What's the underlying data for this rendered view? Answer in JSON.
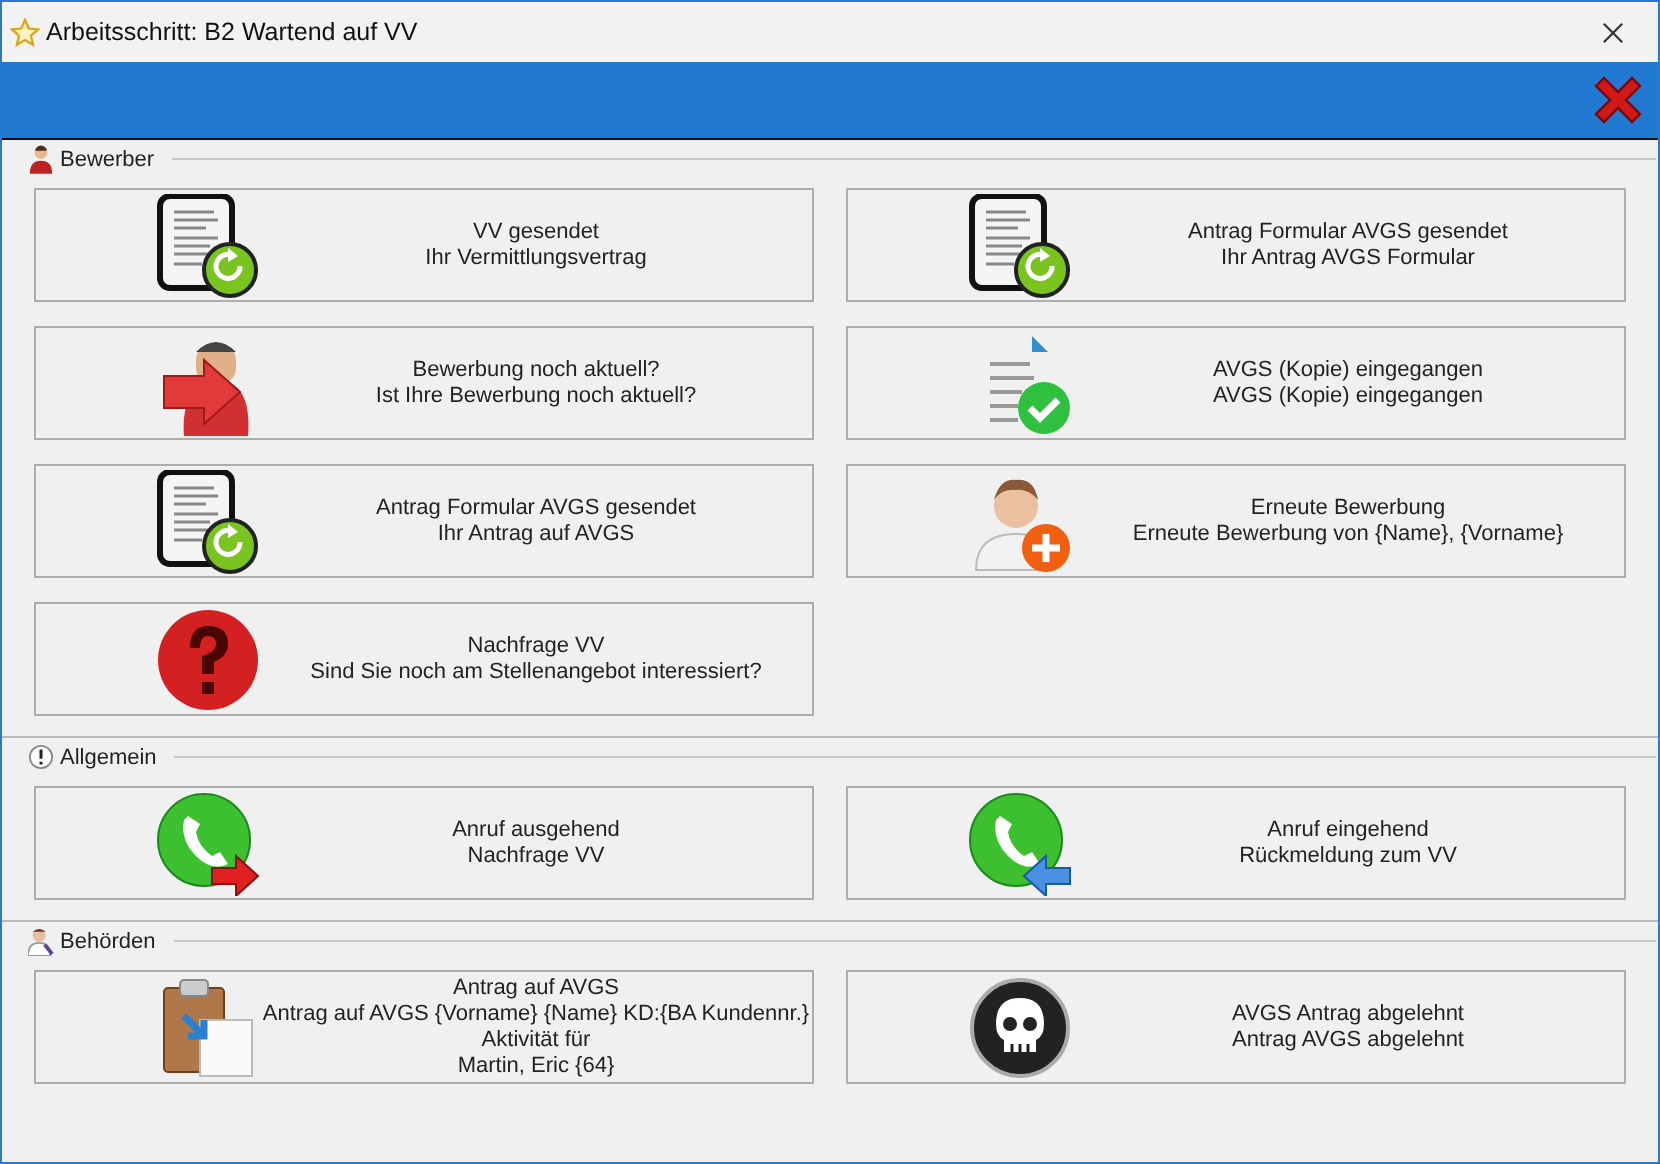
{
  "window": {
    "title": "Arbeitsschritt: B2 Wartend auf VV"
  },
  "sections": [
    {
      "title": "Bewerber",
      "kind": "person",
      "actions": [
        {
          "kind": "doc-refresh",
          "lines": [
            "VV gesendet",
            "Ihr Vermittlungsvertrag"
          ]
        },
        {
          "kind": "doc-refresh",
          "lines": [
            "Antrag Formular AVGS gesendet",
            "Ihr Antrag AVGS Formular"
          ]
        },
        {
          "kind": "person-arrow",
          "lines": [
            "Bewerbung noch aktuell?",
            "Ist Ihre Bewerbung noch aktuell?"
          ]
        },
        {
          "kind": "doc-check",
          "lines": [
            "AVGS (Kopie) eingegangen",
            "AVGS (Kopie) eingegangen"
          ]
        },
        {
          "kind": "doc-refresh",
          "lines": [
            "Antrag Formular AVGS gesendet",
            "Ihr Antrag auf AVGS"
          ]
        },
        {
          "kind": "person-add",
          "lines": [
            "Erneute Bewerbung",
            "Erneute Bewerbung von {Name}, {Vorname}"
          ]
        },
        {
          "kind": "question",
          "lines": [
            "Nachfrage VV",
            "Sind Sie noch am Stellenangebot interessiert?"
          ]
        }
      ]
    },
    {
      "title": "Allgemein",
      "kind": "exclamation",
      "actions": [
        {
          "kind": "phone-out",
          "lines": [
            "Anruf ausgehend",
            "Nachfrage VV"
          ]
        },
        {
          "kind": "phone-in",
          "lines": [
            "Anruf eingehend",
            "Rückmeldung zum VV"
          ]
        }
      ]
    },
    {
      "title": "Behörden",
      "kind": "official",
      "actions": [
        {
          "kind": "clipboard",
          "lines": [
            "Antrag auf AVGS",
            "Antrag auf AVGS {Vorname} {Name} KD:{BA Kundennr.}",
            "Aktivität für",
            "Martin, Eric {64}"
          ]
        },
        {
          "kind": "skull",
          "lines": [
            "AVGS Antrag abgelehnt",
            "Antrag AVGS abgelehnt"
          ]
        }
      ]
    }
  ]
}
